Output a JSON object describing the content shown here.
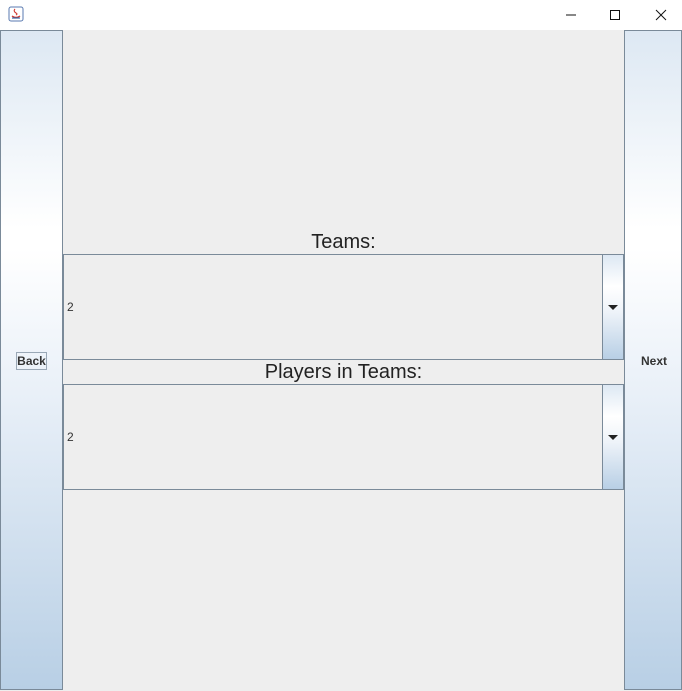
{
  "window": {
    "icon": "java-icon",
    "controls": [
      "minimize-icon",
      "maximize-icon",
      "close-icon"
    ]
  },
  "nav": {
    "back_label": "Back",
    "next_label": "Next"
  },
  "teams": {
    "label": "Teams:",
    "selected": "2"
  },
  "players": {
    "label": "Players in Teams:",
    "selected": "2"
  }
}
